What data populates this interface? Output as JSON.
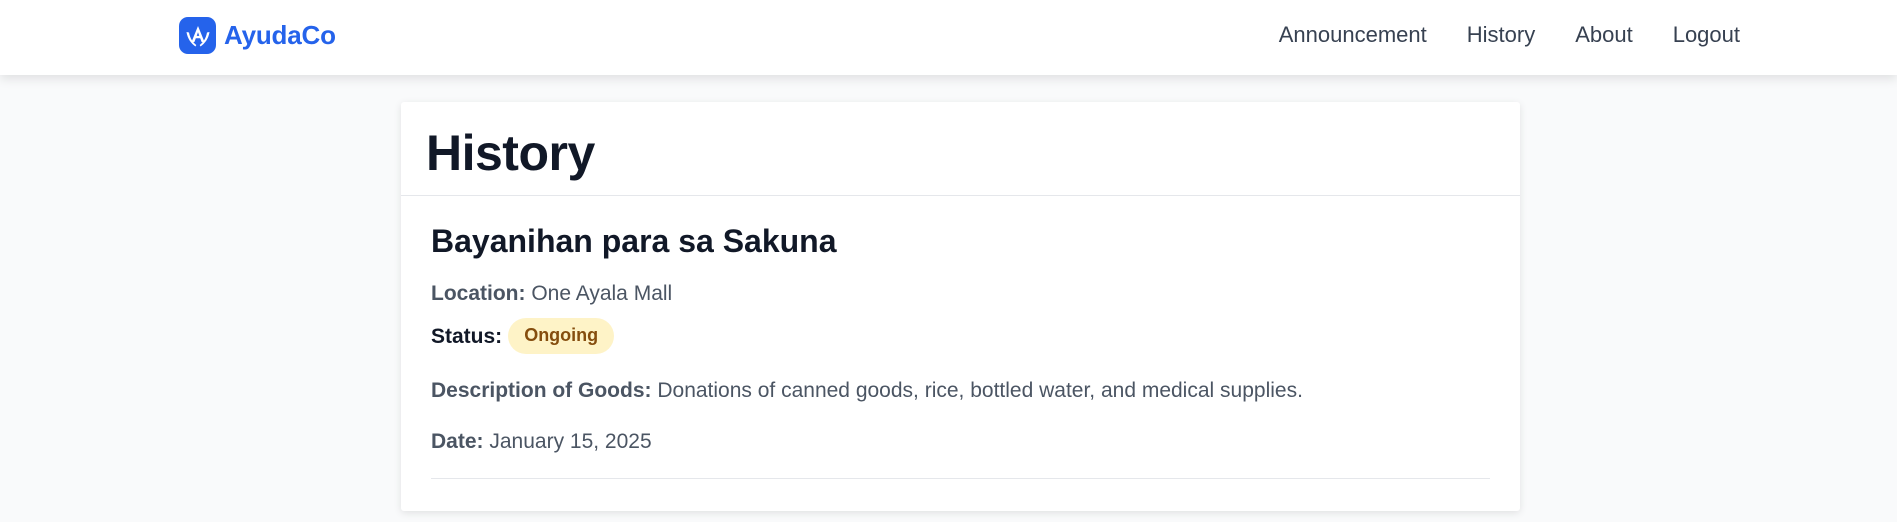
{
  "brand": {
    "name": "AyudaCo",
    "logo_icon": "helping-hands-logo-icon",
    "color": "#2563eb"
  },
  "nav": {
    "items": [
      {
        "label": "Announcement"
      },
      {
        "label": "History"
      },
      {
        "label": "About"
      },
      {
        "label": "Logout"
      }
    ]
  },
  "page": {
    "title": "History"
  },
  "entries": [
    {
      "title": "Bayanihan para sa Sakuna",
      "location_label": "Location:",
      "location": "One Ayala Mall",
      "status_label": "Status:",
      "status": "Ongoing",
      "status_bg": "#fef3c7",
      "status_color": "#854d0e",
      "description_label": "Description of Goods:",
      "description": "Donations of canned goods, rice, bottled water, and medical supplies.",
      "date_label": "Date:",
      "date": "January 15, 2025"
    }
  ]
}
